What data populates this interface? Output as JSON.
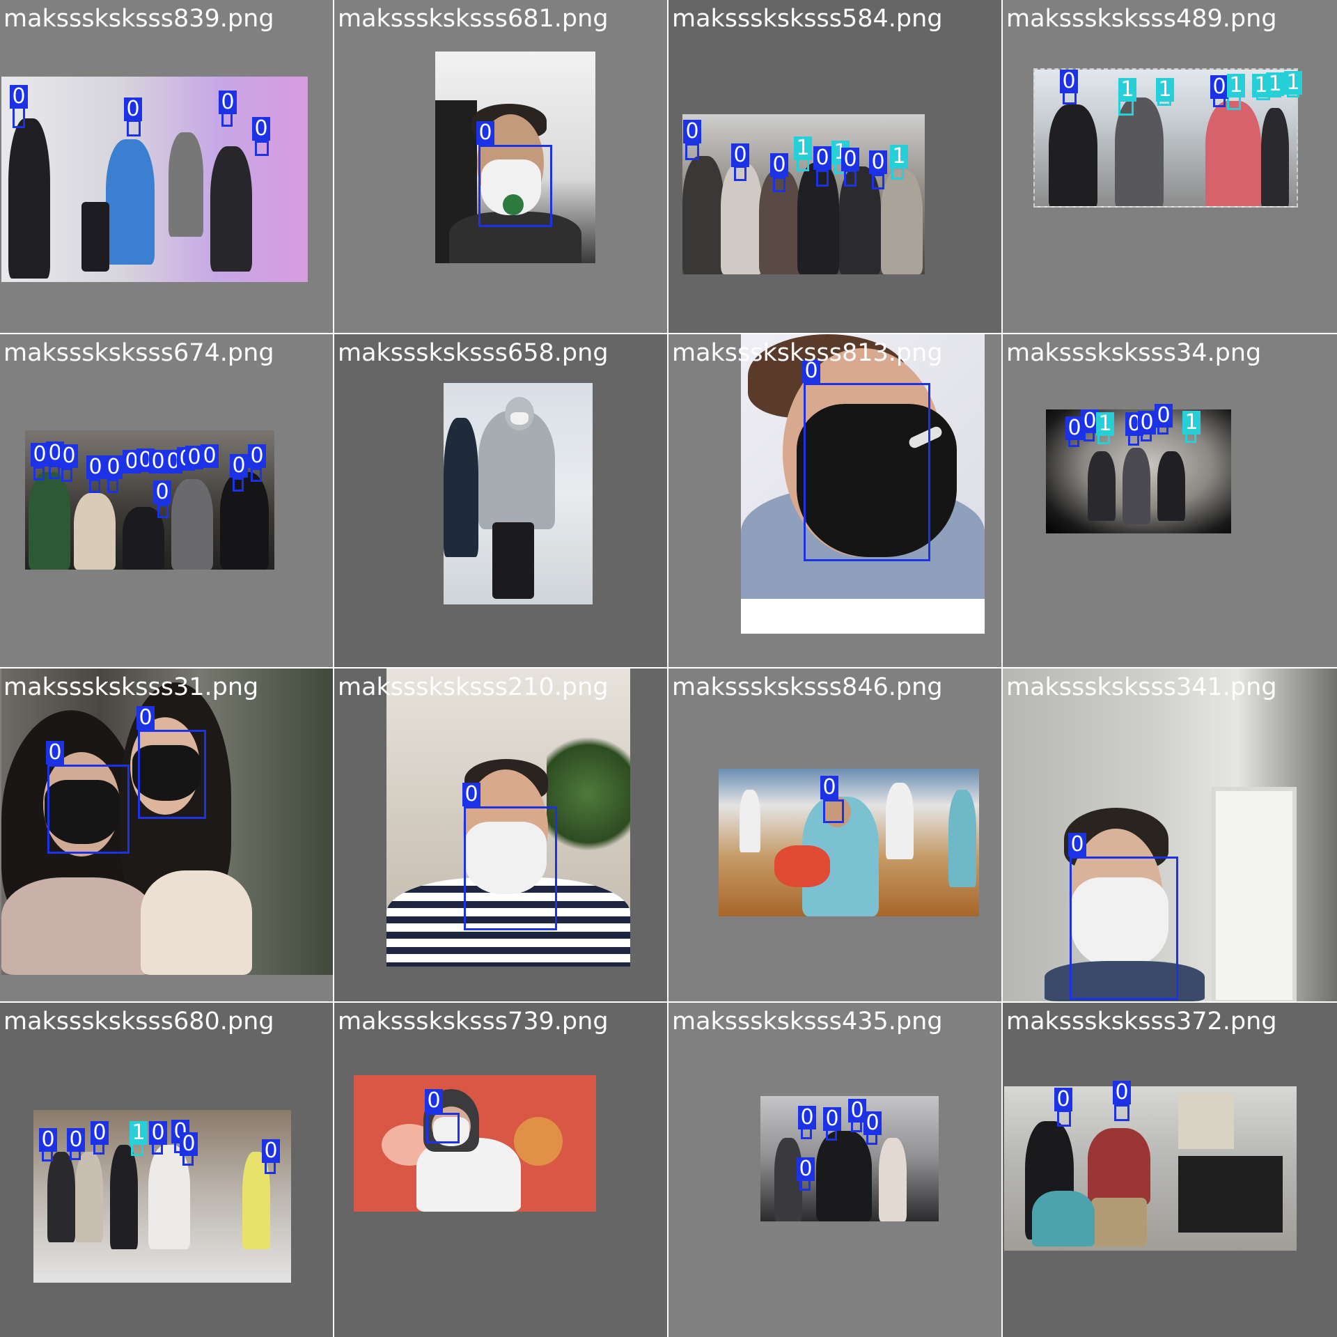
{
  "tiles": [
    {
      "filename": "maksssksksss839.png",
      "detections": [
        "0",
        "0",
        "0",
        "0"
      ],
      "accent": "#b9a6ee"
    },
    {
      "filename": "maksssksksss681.png",
      "detections": [
        "0"
      ],
      "accent": "#dedede"
    },
    {
      "filename": "maksssksksss584.png",
      "detections": [
        "0",
        "0",
        "0",
        "1",
        "0",
        "1",
        "0",
        "0",
        "1"
      ],
      "accent": "#8a8680"
    },
    {
      "filename": "maksssksksss489.png",
      "detections": [
        "0",
        "1",
        "1",
        "0",
        "1",
        "1",
        "1",
        "1"
      ],
      "accent": "#d9e4ec"
    },
    {
      "filename": "maksssksksss674.png",
      "detections": [
        "0",
        "0",
        "0",
        "0",
        "0",
        "0",
        "0",
        "0",
        "0",
        "0",
        "0",
        "0",
        "0",
        "0",
        "0"
      ],
      "accent": "#6f6a66"
    },
    {
      "filename": "maksssksksss658.png",
      "detections": [],
      "accent": "#dfe4ea"
    },
    {
      "filename": "maksssksksss813.png",
      "detections": [
        "0"
      ],
      "accent": "#ececf2"
    },
    {
      "filename": "maksssksksss34.png",
      "detections": [
        "0",
        "0",
        "1",
        "0",
        "0",
        "0",
        "1"
      ],
      "accent": "#5d5d62"
    },
    {
      "filename": "maksssksksss31.png",
      "detections": [
        "0",
        "0"
      ],
      "accent": "#6b6b64"
    },
    {
      "filename": "maksssksksss210.png",
      "detections": [
        "0"
      ],
      "accent": "#e4e0da"
    },
    {
      "filename": "maksssksksss846.png",
      "detections": [
        "0"
      ],
      "accent": "#c7915a"
    },
    {
      "filename": "maksssksksss341.png",
      "detections": [
        "0"
      ],
      "accent": "#c9c9c6"
    },
    {
      "filename": "maksssksksss680.png",
      "detections": [
        "0",
        "0",
        "0",
        "1",
        "0",
        "0",
        "0",
        "0"
      ],
      "accent": "#b9b2aa"
    },
    {
      "filename": "maksssksksss739.png",
      "detections": [
        "0"
      ],
      "accent": "#d85745"
    },
    {
      "filename": "maksssksksss435.png",
      "detections": [
        "0",
        "0",
        "0",
        "0",
        "0"
      ],
      "accent": "#9a9a9c"
    },
    {
      "filename": "maksssksksss372.png",
      "detections": [
        "0",
        "0"
      ],
      "accent": "#b7b7b5"
    }
  ],
  "colors": {
    "class_0": "#1b32e6",
    "class_1": "#27d0d8",
    "tile_light": "#808080",
    "tile_dark": "#666666"
  }
}
